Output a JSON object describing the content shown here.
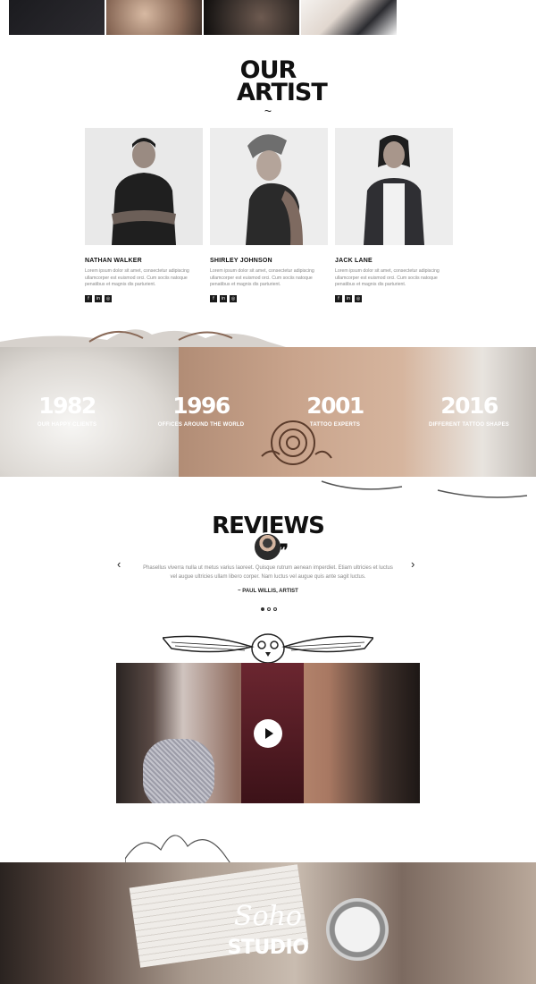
{
  "artists_section": {
    "title": "OUR ARTIST",
    "divider": "~",
    "artists": [
      {
        "name": "NATHAN WALKER",
        "bio": "Lorem ipsum dolor sit amet, consectetur adipiscing ullamcorper est euismod orci. Cum sociis natoque penatibus et magnis dis parturient."
      },
      {
        "name": "SHIRLEY JOHNSON",
        "bio": "Lorem ipsum dolor sit amet, consectetur adipiscing ullamcorper est euismod orci. Cum sociis natoque penatibus et magnis dis parturient."
      },
      {
        "name": "JACK LANE",
        "bio": "Lorem ipsum dolor sit amet, consectetur adipiscing ullamcorper est euismod orci. Cum sociis natoque penatibus et magnis dis parturient."
      }
    ],
    "social_icons": [
      "facebook-icon",
      "linkedin-icon",
      "instagram-icon"
    ]
  },
  "stats": [
    {
      "number": "1982",
      "label": "OUR HAPPY CLIENTS"
    },
    {
      "number": "1996",
      "label": "OFFICES AROUND THE WORLD"
    },
    {
      "number": "2001",
      "label": "TATTOO EXPERTS"
    },
    {
      "number": "2016",
      "label": "DIFFERENT TATTOO SHAPES"
    }
  ],
  "reviews": {
    "title": "REVIEWS",
    "quote": "Phasellus viverra nulla ut metus varius laoreet. Quisque rutrum aenean imperdiet. Etiam ultricies et luctus vel augue ultricies ullam libero corper. Nam luctus vel augue quis ante sagit luctus.",
    "author": "~ PAUL WILLIS, ARTIST",
    "prev_arrow": "‹",
    "next_arrow": "›",
    "quote_glyph": "❞",
    "dots": 3,
    "active_dot": 0
  },
  "footer": {
    "logo_script": "Soho",
    "logo_main": "STUDIO"
  },
  "colors": {
    "text_dark": "#111111",
    "text_muted": "#888888",
    "social_bg": "#1a1a1a",
    "white": "#ffffff"
  }
}
